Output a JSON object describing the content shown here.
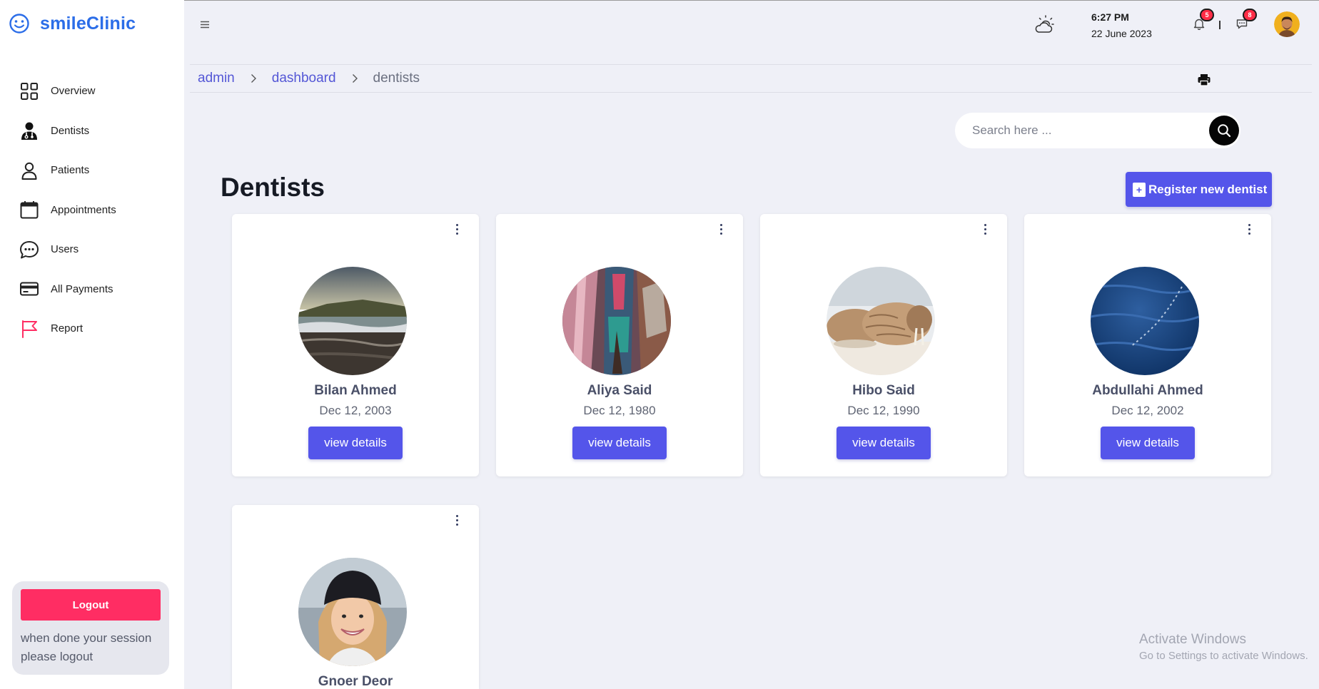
{
  "brand": {
    "name": "smileClinic",
    "icon": "smiley-icon",
    "color": "#2b6de8"
  },
  "sidebar": {
    "items": [
      {
        "label": "Overview",
        "icon": "grid-icon"
      },
      {
        "label": "Dentists",
        "icon": "doctor-icon"
      },
      {
        "label": "Patients",
        "icon": "user-icon"
      },
      {
        "label": "Appointments",
        "icon": "calendar-icon"
      },
      {
        "label": "Users",
        "icon": "chat-icon"
      },
      {
        "label": "All Payments",
        "icon": "credit-card-icon"
      },
      {
        "label": "Report",
        "icon": "flag-icon"
      }
    ],
    "logout": {
      "button_label": "Logout",
      "note": "when done your session please logout",
      "color": "#ff2d63"
    }
  },
  "topbar": {
    "time": "6:27 PM",
    "date": "22 June 2023",
    "notifications_count": "5",
    "messages_count": "8",
    "weather_icon": "cloud-sun-icon"
  },
  "breadcrumb": {
    "items": [
      "admin",
      "dashboard"
    ],
    "current": "dentists"
  },
  "search": {
    "placeholder": "Search here ..."
  },
  "page": {
    "title": "Dentists",
    "register_label": "Register new dentist",
    "accent": "#5455ea"
  },
  "dentists": [
    {
      "name": "Bilan Ahmed",
      "dob": "Dec 12, 2003",
      "button": "view details"
    },
    {
      "name": "Aliya Said",
      "dob": "Dec 12, 1980",
      "button": "view details"
    },
    {
      "name": "Hibo Said",
      "dob": "Dec 12, 1990",
      "button": "view details"
    },
    {
      "name": "Abdullahi Ahmed",
      "dob": "Dec 12, 2002",
      "button": "view details"
    },
    {
      "name": "Gnoer Deor",
      "dob": "",
      "button": ""
    }
  ],
  "watermark": {
    "title": "Activate Windows",
    "subtitle": "Go to Settings to activate Windows."
  }
}
